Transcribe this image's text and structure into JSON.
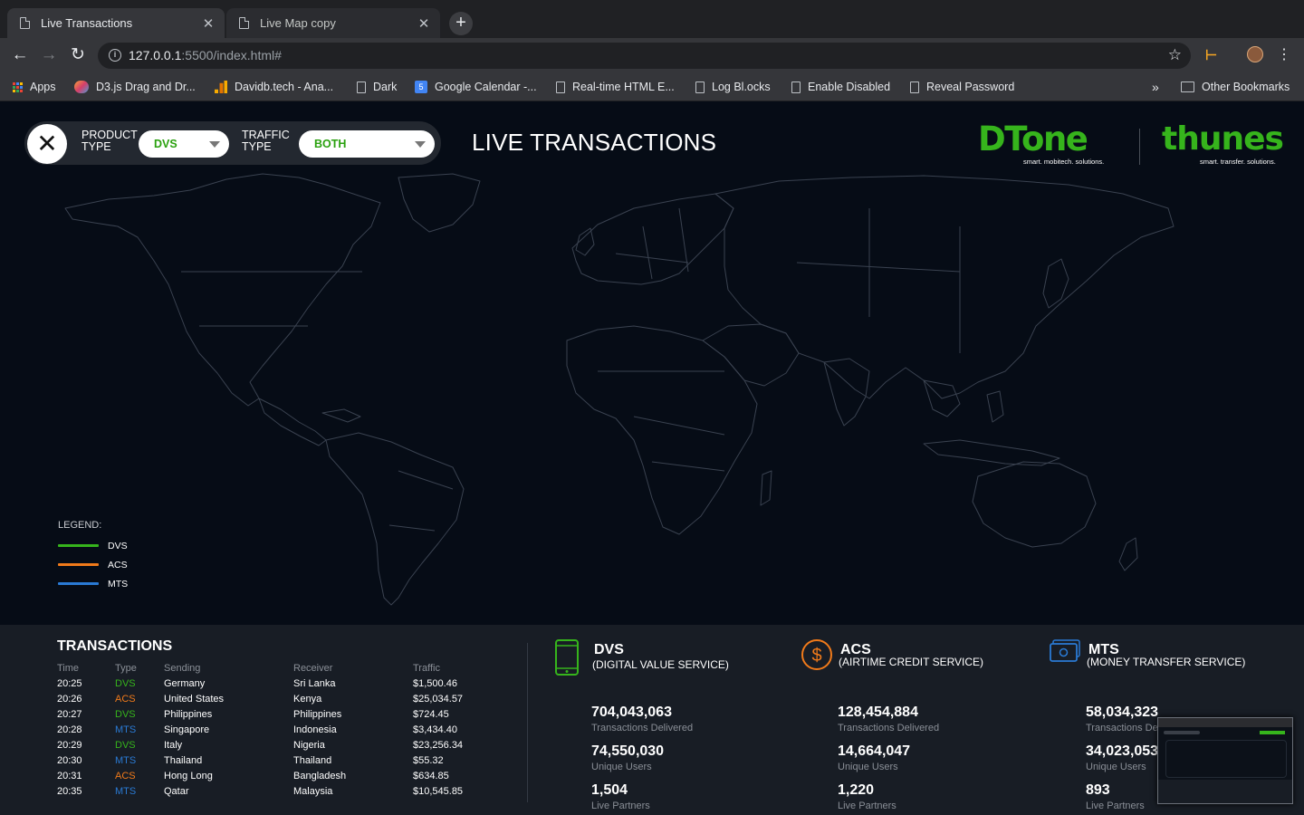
{
  "browser": {
    "tabs": [
      {
        "title": "Live Transactions",
        "active": true
      },
      {
        "title": "Live Map copy",
        "active": false
      }
    ],
    "new_tab_symbol": "+",
    "close_symbol": "✕",
    "url_host": "127.0.0.1",
    "url_path": ":5500/index.html#",
    "bookmarks": [
      {
        "label": "Apps",
        "icon": "apps-grid-icon"
      },
      {
        "label": "D3.js Drag and Dr...",
        "icon": "d3-favicon-icon"
      },
      {
        "label": "Davidb.tech - Ana...",
        "icon": "analytics-bars-icon"
      },
      {
        "label": "Dark",
        "icon": "page-icon"
      },
      {
        "label": "Google Calendar -...",
        "icon": "calendar-icon"
      },
      {
        "label": "Real-time HTML E...",
        "icon": "page-icon"
      },
      {
        "label": "Log Bl.ocks",
        "icon": "page-icon"
      },
      {
        "label": "Enable Disabled",
        "icon": "page-icon"
      },
      {
        "label": "Reveal Password",
        "icon": "page-icon"
      }
    ],
    "overflow": "»",
    "other_bookmarks": "Other Bookmarks",
    "calendar_day": "5"
  },
  "controls": {
    "product_type_label": "PRODUCT TYPE",
    "product_type_value": "DVS",
    "traffic_type_label": "TRAFFIC TYPE",
    "traffic_type_value": "BOTH"
  },
  "title": "LIVE TRANSACTIONS",
  "logos": {
    "dtone_word": "DTone",
    "dtone_tag": "smart. mobitech. solutions.",
    "thunes_word": "thunes",
    "thunes_tag": "smart. transfer. solutions."
  },
  "legend": {
    "title": "LEGEND:",
    "items": [
      {
        "label": "DVS",
        "color": "#36b41c"
      },
      {
        "label": "ACS",
        "color": "#f07a1a"
      },
      {
        "label": "MTS",
        "color": "#2a7ad4"
      }
    ]
  },
  "transactions": {
    "title": "TRANSACTIONS",
    "headers": {
      "time": "Time",
      "type": "Type",
      "sending": "Sending",
      "receiver": "Receiver",
      "traffic": "Traffic"
    },
    "rows": [
      {
        "time": "20:25",
        "type": "DVS",
        "sending": "Germany",
        "receiver": "Sri Lanka",
        "traffic": "$1,500.46"
      },
      {
        "time": "20:26",
        "type": "ACS",
        "sending": "United States",
        "receiver": "Kenya",
        "traffic": "$25,034.57"
      },
      {
        "time": "20:27",
        "type": "DVS",
        "sending": "Philippines",
        "receiver": "Philippines",
        "traffic": "$724.45"
      },
      {
        "time": "20:28",
        "type": "MTS",
        "sending": "Singapore",
        "receiver": "Indonesia",
        "traffic": "$3,434.40"
      },
      {
        "time": "20:29",
        "type": "DVS",
        "sending": "Italy",
        "receiver": "Nigeria",
        "traffic": "$23,256.34"
      },
      {
        "time": "20:30",
        "type": "MTS",
        "sending": "Thailand",
        "receiver": "Thailand",
        "traffic": "$55.32"
      },
      {
        "time": "20:31",
        "type": "ACS",
        "sending": "Hong Long",
        "receiver": "Bangladesh",
        "traffic": "$634.85"
      },
      {
        "time": "20:35",
        "type": "MTS",
        "sending": "Qatar",
        "receiver": "Malaysia",
        "traffic": "$10,545.85"
      }
    ]
  },
  "stats": [
    {
      "code": "DVS",
      "name": "(DIGITAL VALUE SERVICE)",
      "icon": "mobile-phone-icon",
      "color": "#36b41c",
      "transactions": "704,043,063",
      "transactions_label": "Transactions Delivered",
      "users": "74,550,030",
      "users_label": "Unique Users",
      "partners": "1,504",
      "partners_label": "Live Partners"
    },
    {
      "code": "ACS",
      "name": "(AIRTIME CREDIT SERVICE)",
      "icon": "dollar-circle-icon",
      "color": "#f07a1a",
      "transactions": "128,454,884",
      "transactions_label": "Transactions Delivered",
      "users": "14,664,047",
      "users_label": "Unique Users",
      "partners": "1,220",
      "partners_label": "Live Partners"
    },
    {
      "code": "MTS",
      "name": "(MONEY TRANSFER SERVICE)",
      "icon": "banknote-icon",
      "color": "#2a7ad4",
      "transactions": "58,034,323",
      "transactions_label": "Transactions Delivered",
      "users": "34,023,053",
      "users_label": "Unique Users",
      "partners": "893",
      "partners_label": "Live Partners"
    }
  ]
}
